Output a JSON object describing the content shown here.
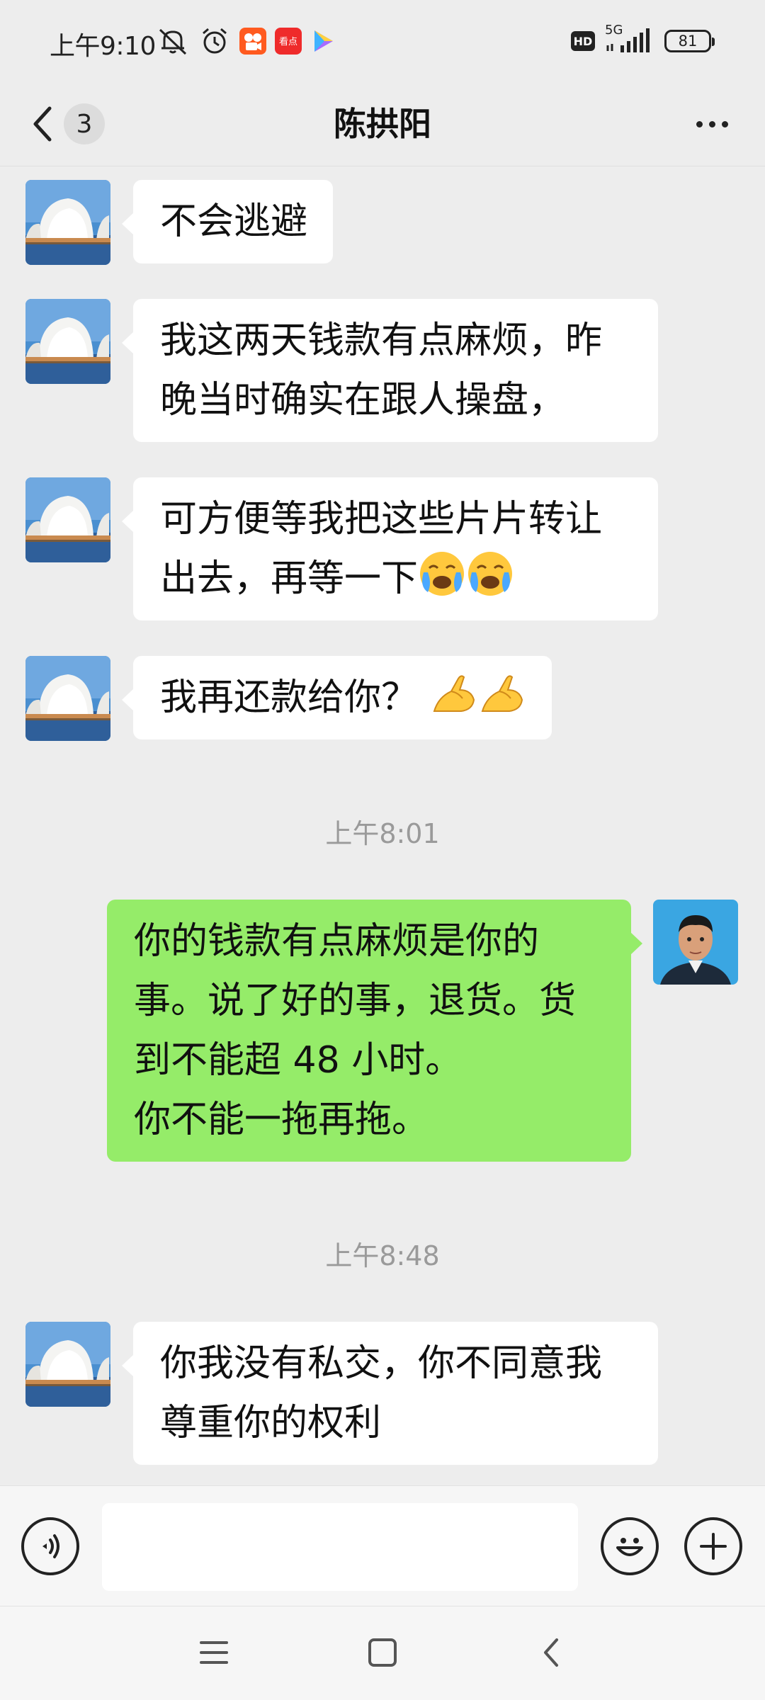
{
  "status_bar": {
    "time": "上午9:10",
    "network": "5G",
    "hd_label": "HD",
    "battery": "81",
    "app_badge_label": "看点"
  },
  "header": {
    "title": "陈拱阳",
    "unread_count": "3"
  },
  "messages": [
    {
      "side": "in",
      "lines": [
        "不会逃避"
      ]
    },
    {
      "side": "in",
      "lines": [
        "我这两天钱款有点麻烦，昨",
        "晚当时确实在跟人操盘，"
      ]
    },
    {
      "side": "in",
      "lines": [
        "可方便等我把这些片片转让",
        "出去，再等一下"
      ],
      "emoji": "crying-emoji"
    },
    {
      "side": "in",
      "lines": [
        "我再还款给你？"
      ],
      "emoji": "pinching-hand-emoji"
    },
    {
      "type": "time",
      "text": "上午8:01"
    },
    {
      "side": "out",
      "lines": [
        "你的钱款有点麻烦是你的",
        "事。说了好的事，退货。货",
        "到不能超 48 小时。",
        "你不能一拖再拖。"
      ]
    },
    {
      "type": "time",
      "text": "上午8:48"
    },
    {
      "side": "in",
      "lines": [
        "你我没有私交，你不同意我",
        "尊重你的权利"
      ]
    }
  ],
  "input": {
    "value": "",
    "placeholder": ""
  },
  "icons": {
    "voice": "voice-input-icon",
    "emoji": "emoji-icon",
    "more": "plus-icon",
    "back": "chevron-left-icon",
    "menu": "menu-icon",
    "home": "home-icon",
    "sys_back": "back-icon"
  },
  "colors": {
    "background": "#ededed",
    "incoming_bubble": "#ffffff",
    "outgoing_bubble": "#95ec69",
    "timestamp": "#9a9a9a"
  }
}
